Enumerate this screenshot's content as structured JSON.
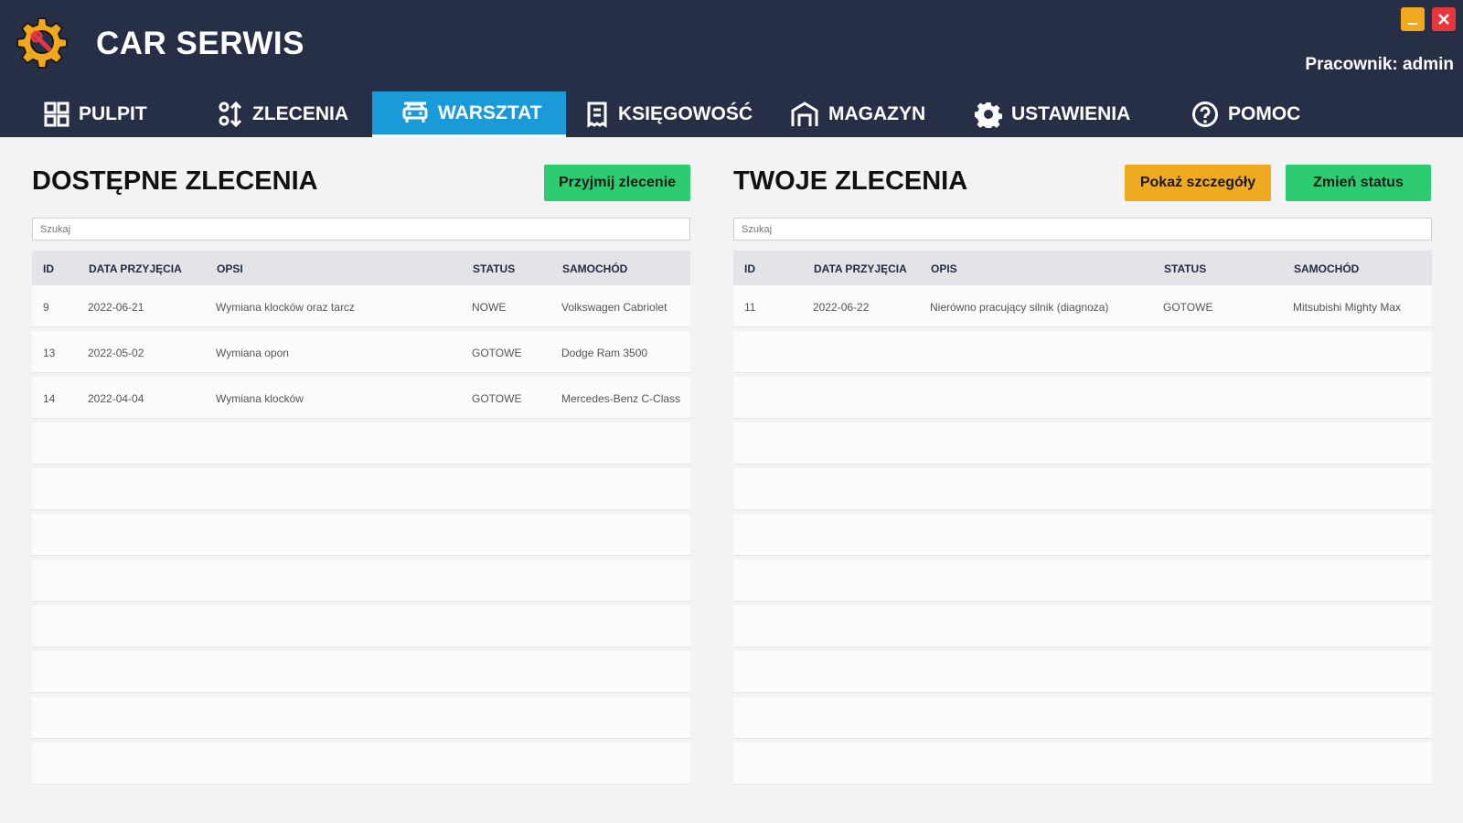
{
  "app": {
    "title": "CAR SERWIS",
    "worker_label": "Pracownik: admin"
  },
  "nav": [
    {
      "label": "PULPIT",
      "icon": "grid-icon",
      "active": false
    },
    {
      "label": "ZLECENIA",
      "icon": "sort-icon",
      "active": false
    },
    {
      "label": "WARSZTAT",
      "icon": "car-icon",
      "active": true
    },
    {
      "label": "KSIĘGOWOŚĆ",
      "icon": "receipt-icon",
      "active": false
    },
    {
      "label": "MAGAZYN",
      "icon": "warehouse-icon",
      "active": false
    },
    {
      "label": "USTAWIENIA",
      "icon": "gear-icon",
      "active": false
    },
    {
      "label": "POMOC",
      "icon": "help-icon",
      "active": false
    }
  ],
  "colors": {
    "header": "#262f45",
    "active_tab": "#1a9ad6",
    "green": "#2ecc71",
    "orange": "#f0aa22",
    "close": "#e8363b",
    "minimize": "#f2a81d"
  },
  "available": {
    "title": "DOSTĘPNE ZLECENIA",
    "accept_button": "Przyjmij zlecenie",
    "search_placeholder": "Szukaj",
    "columns": [
      "ID",
      "DATA PRZYJĘCIA",
      "OPSI",
      "STATUS",
      "SAMOCHÓD"
    ],
    "rows": [
      [
        "9",
        "2022-06-21",
        "Wymiana klocków oraz tarcz",
        "NOWE",
        "Volkswagen Cabriolet"
      ],
      [
        "13",
        "2022-05-02",
        "Wymiana opon",
        "GOTOWE",
        "Dodge Ram 3500"
      ],
      [
        "14",
        "2022-04-04",
        "Wymiana klocków",
        "GOTOWE",
        "Mercedes-Benz C-Class"
      ]
    ]
  },
  "yours": {
    "title": "TWOJE ZLECENIA",
    "details_button": "Pokaż szczegóły",
    "status_button": "Zmień status",
    "search_placeholder": "Szukaj",
    "columns": [
      "ID",
      "DATA PRZYJĘCIA",
      "OPIS",
      "STATUS",
      "SAMOCHÓD"
    ],
    "rows": [
      [
        "11",
        "2022-06-22",
        "Nierówno pracujący silnik (diagnoza)",
        "GOTOWE",
        "Mitsubishi Mighty Max"
      ]
    ]
  }
}
